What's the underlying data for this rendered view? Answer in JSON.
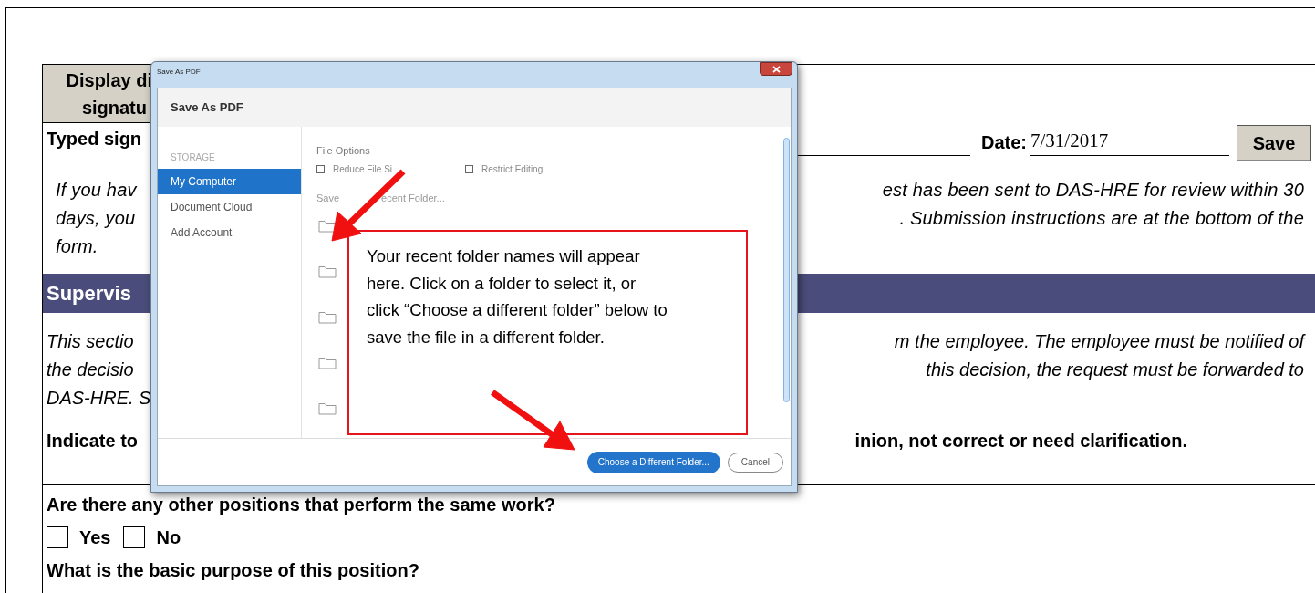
{
  "form": {
    "signature_header": [
      "Display di",
      "signatu"
    ],
    "typed_signature_label": "Typed sign",
    "date_label": "Date:",
    "date_value": "7/31/2017",
    "save_button": "Save",
    "notice_left": [
      "If you hav",
      "days, you",
      "form."
    ],
    "notice_right": [
      "est has been sent to DAS-HRE for review within 30",
      ". Submission instructions are at the bottom of the"
    ],
    "section_title": "Supervis",
    "section_left": [
      "This sectio",
      "the decisio",
      "DAS-HRE. S"
    ],
    "section_right": [
      "m the employee. The employee must be notified of",
      "this decision, the request must be forwarded to"
    ],
    "indicate_left": "Indicate to",
    "indicate_right": "inion, not correct or need clarification.",
    "question_1": "Are there any other positions that perform the same work?",
    "options": [
      {
        "label": "Yes",
        "checked": false
      },
      {
        "label": "No",
        "checked": false
      }
    ],
    "question_2": "What is the basic purpose of this position?"
  },
  "dialog": {
    "window_title": "Save As PDF",
    "header": "Save As PDF",
    "sidebar": {
      "section": "STORAGE",
      "items": [
        {
          "label": "My Computer",
          "selected": true
        },
        {
          "label": "Document Cloud",
          "selected": false
        },
        {
          "label": "Add Account",
          "selected": false
        }
      ]
    },
    "file_options": {
      "title": "File Options",
      "options": [
        {
          "label": "Reduce File Si",
          "checked": false
        },
        {
          "label": "Restrict Editing",
          "checked": false
        }
      ]
    },
    "recent_title": [
      "Save",
      "ecent Folder..."
    ],
    "buttons": [
      {
        "label": "Choose a Different Folder...",
        "kind": "primary"
      },
      {
        "label": "Cancel",
        "kind": "secondary"
      }
    ]
  },
  "callout": {
    "text": "Your recent folder names will appear here. Click on a folder to select it, or click “Choose a different folder” below to save the file in a different folder."
  }
}
